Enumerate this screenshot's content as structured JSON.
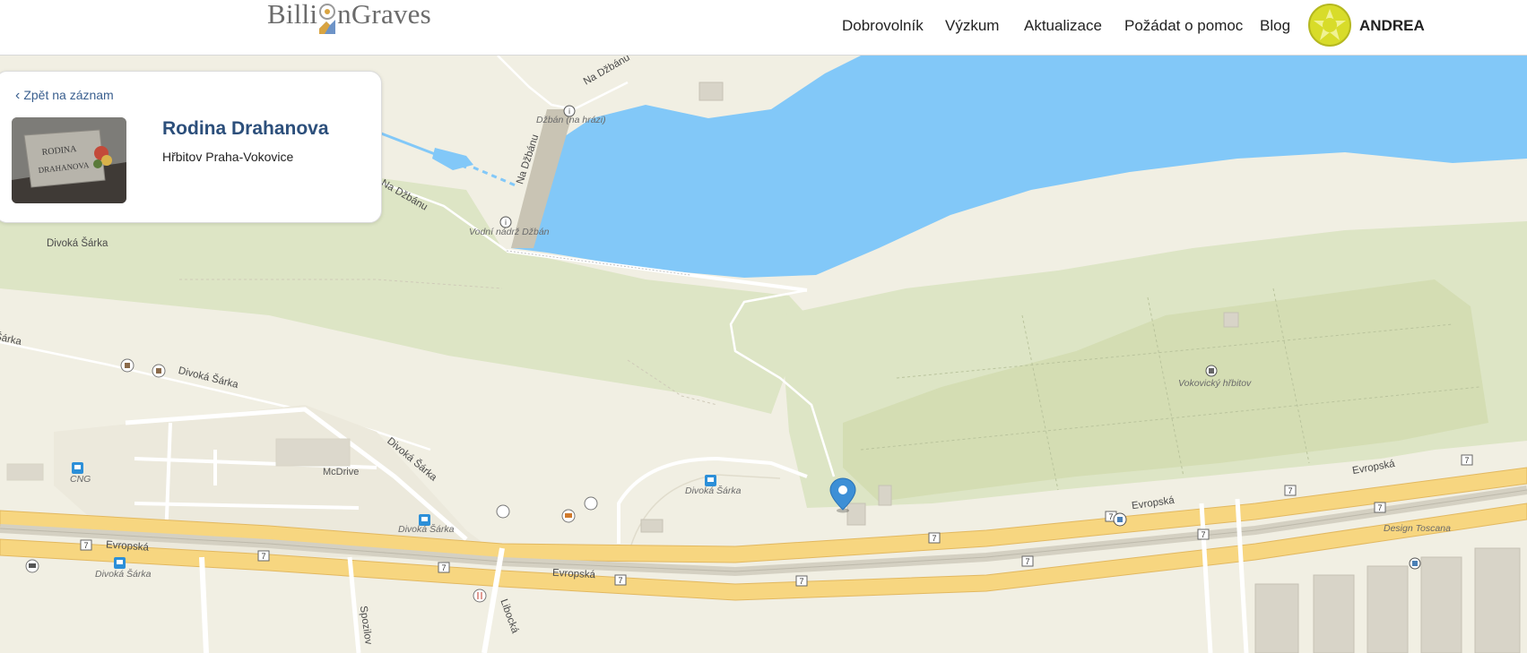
{
  "header": {
    "logo_part1": "Billi",
    "logo_part2": "nGraves",
    "nav": [
      {
        "label": "Dobrovolník"
      },
      {
        "label": "Výzkum"
      },
      {
        "label": "Aktualizace"
      },
      {
        "label": "Požádat o pomoc"
      },
      {
        "label": "Blog"
      }
    ],
    "user_name": "ANDREA"
  },
  "card": {
    "back_label": "Zpět na záznam",
    "title": "Rodina Drahanova",
    "subtitle": "Hřbitov Praha-Vokovice",
    "photo_text_1": "RODINA",
    "photo_text_2": "DRAHANOVA"
  },
  "map": {
    "labels": {
      "na_dzbanu_top": "Na Džbánu",
      "dzban_na_hrazi": "Džbán (na hrázi)",
      "na_dzbanu_mid": "Na Džbánu",
      "na_dzbanu_left": "Na Džbánu",
      "vodni_nadrz": "Vodní nádrž Džbán",
      "divoka_sarka_1": "Divoká Šárka",
      "sarka_edge": "Šárka",
      "divoka_sarka_2": "Divoká Šárka",
      "divoka_sarka_3": "Divoká Šárka",
      "mcdrive": "McDrive",
      "cng": "CNG",
      "divoka_sarka_stop1": "Divoká Šárka",
      "divoka_sarka_stop2": "Divoká Šárka",
      "divoka_sarka_stop3": "Divoká Šárka",
      "vokovicky_hrbitov": "Vokovický hřbitov",
      "evropska_1": "Evropská",
      "evropska_2": "Evropská",
      "evropska_3": "Evropská",
      "evropska_4": "Evropská",
      "design_toscana": "Design Toscana",
      "libocka": "Libocká",
      "spozilova": "Spozilov"
    },
    "route_number": "7",
    "colors": {
      "water": "#82c8f8",
      "park": "#dde5c5",
      "cemetery": "#d4ddb3",
      "land": "#f1efe3",
      "main_road": "#f7d680",
      "pin": "#3d8fd6"
    }
  }
}
